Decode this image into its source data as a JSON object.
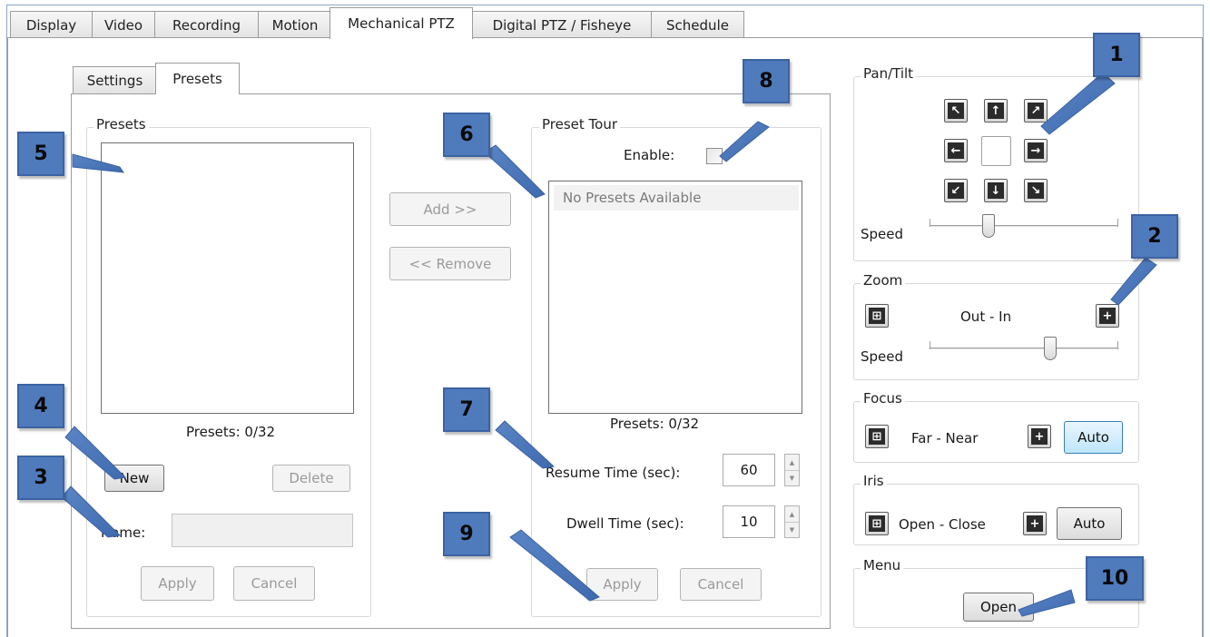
{
  "tabs": [
    "Display",
    "Video",
    "Recording",
    "Motion",
    "Mechanical PTZ",
    "Digital PTZ / Fisheye",
    "Schedule"
  ],
  "subtabs": [
    "Settings",
    "Presets"
  ],
  "presets": {
    "group_title": "Presets",
    "count_label": "Presets:  0/32",
    "new_button": "New",
    "delete_button": "Delete",
    "name_label": "Name:",
    "name_value": "",
    "apply_button": "Apply",
    "cancel_button": "Cancel"
  },
  "transfer": {
    "add_button": "Add >>",
    "remove_button": "<< Remove"
  },
  "preset_tour": {
    "group_title": "Preset Tour",
    "enable_label": "Enable:",
    "enabled": false,
    "empty_text": "No Presets Available",
    "count_label": "Presets:  0/32",
    "resume_label": "Resume Time (sec):",
    "resume_value": "60",
    "dwell_label": "Dwell Time (sec):",
    "dwell_value": "10",
    "apply_button": "Apply",
    "cancel_button": "Cancel"
  },
  "pan_tilt": {
    "group_title": "Pan/Tilt",
    "speed_label": "Speed",
    "speed_level": 0.3,
    "buttons": [
      "arrow-up-left-icon",
      "arrow-up-icon",
      "arrow-up-right-icon",
      "arrow-left-icon",
      "center",
      "arrow-right-icon",
      "arrow-down-left-icon",
      "arrow-down-icon",
      "arrow-down-right-icon"
    ]
  },
  "zoom": {
    "group_title": "Zoom",
    "range_label": "Out - In",
    "speed_label": "Speed",
    "speed_level": 0.65
  },
  "focus": {
    "group_title": "Focus",
    "range_label": "Far - Near",
    "auto_button": "Auto"
  },
  "iris": {
    "group_title": "Iris",
    "range_label": "Open - Close",
    "auto_button": "Auto"
  },
  "menu": {
    "group_title": "Menu",
    "open_button": "Open"
  },
  "callouts": [
    "1",
    "2",
    "3",
    "4",
    "5",
    "6",
    "7",
    "8",
    "9",
    "10"
  ],
  "colors": {
    "callout_fill": "#4f7bbd",
    "callout_border": "#3c63a3",
    "focus_blue": "#3c7fb1"
  }
}
